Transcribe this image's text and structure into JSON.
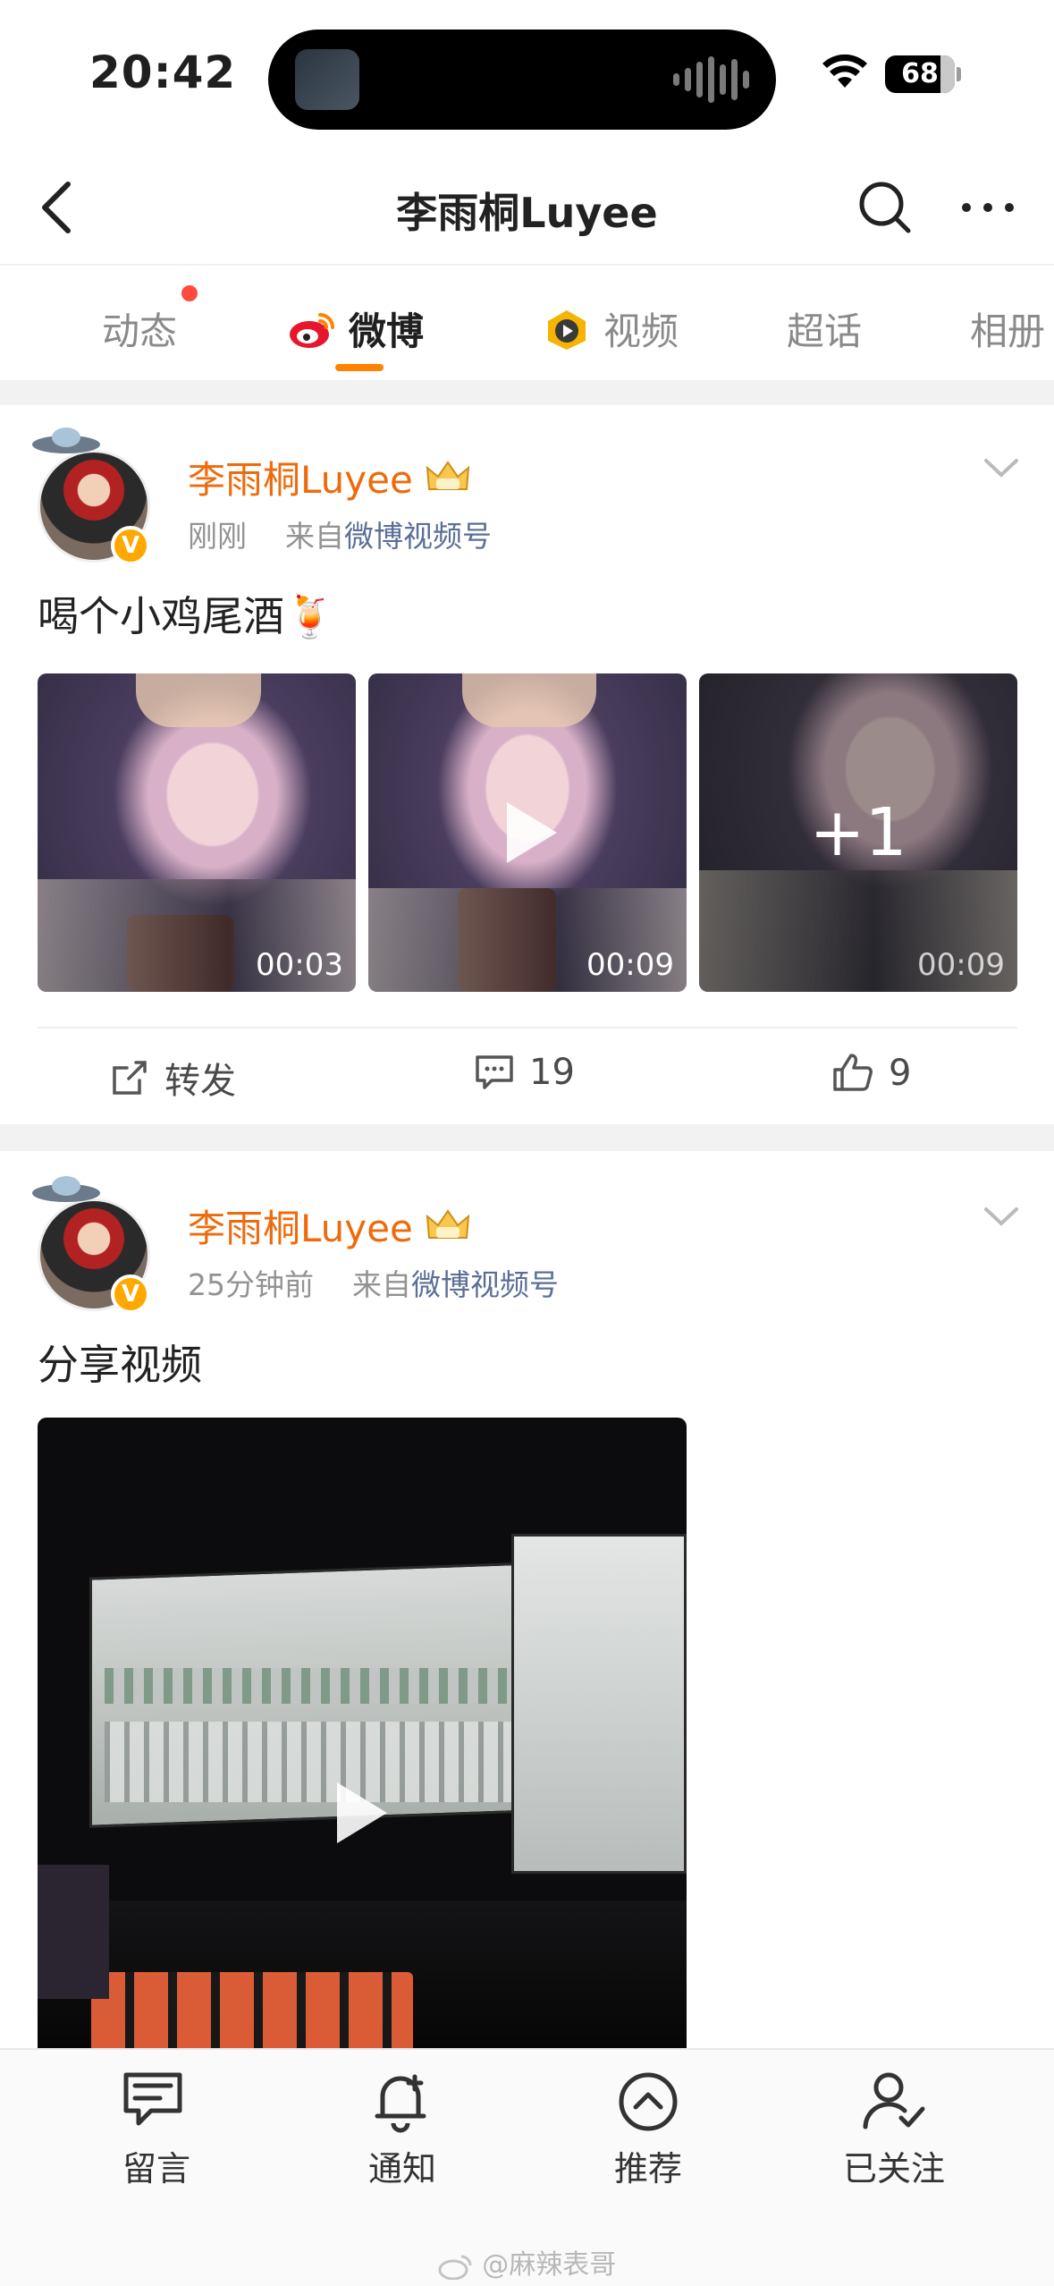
{
  "status_bar": {
    "time": "20:42",
    "battery": "68"
  },
  "nav": {
    "title": "李雨桐Luyee"
  },
  "tabs": [
    {
      "label": "动态",
      "has_dot": true
    },
    {
      "label": "微博",
      "active": true
    },
    {
      "label": "视频"
    },
    {
      "label": "超话"
    },
    {
      "label": "相册"
    }
  ],
  "posts": [
    {
      "author": "李雨桐Luyee",
      "time": "刚刚",
      "source_prefix": "来自",
      "source": "微博视频号",
      "text": "喝个小鸡尾酒🍹",
      "videos": [
        {
          "duration": "00:03"
        },
        {
          "duration": "00:09"
        },
        {
          "duration": "00:09",
          "overlay": "+1"
        }
      ],
      "actions": {
        "repost": "转发",
        "comments": "19",
        "likes": "9"
      }
    },
    {
      "author": "李雨桐Luyee",
      "time": "25分钟前",
      "source_prefix": "来自",
      "source": "微博视频号",
      "text": "分享视频"
    }
  ],
  "bottom_bar": [
    {
      "label": "留言",
      "icon": "message-icon"
    },
    {
      "label": "通知",
      "icon": "bell-icon"
    },
    {
      "label": "推荐",
      "icon": "recommend-icon"
    },
    {
      "label": "已关注",
      "icon": "followed-icon"
    }
  ],
  "watermark": "@麻辣表哥",
  "colors": {
    "accent": "#ff8200",
    "author": "#ed6b0c",
    "source_link": "#5b6f96"
  }
}
